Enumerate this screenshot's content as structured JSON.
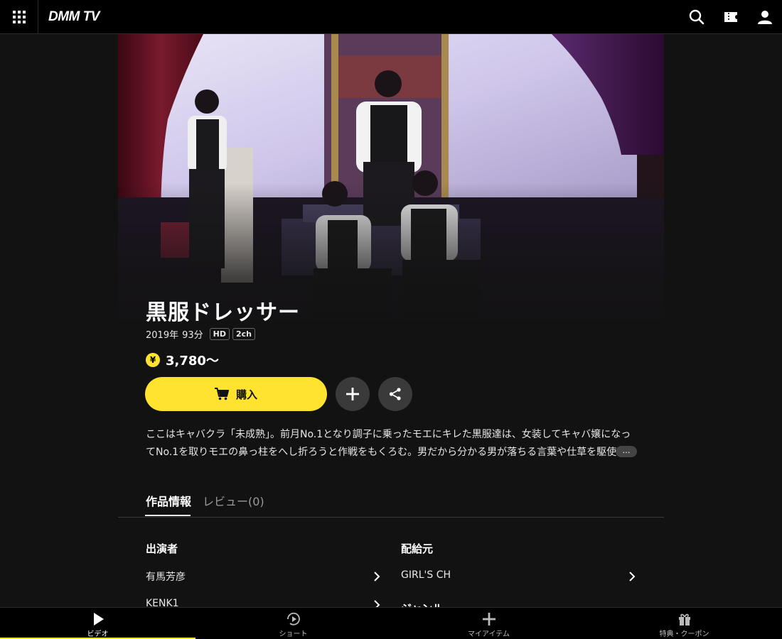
{
  "header": {
    "logo": "DMM TV"
  },
  "title": "黒服ドレッサー",
  "meta": {
    "year": "2019年",
    "duration": "93分",
    "badges": [
      "HD",
      "2ch"
    ]
  },
  "price": {
    "currency_symbol": "¥",
    "value": "3,780〜"
  },
  "actions": {
    "buy_label": "購入"
  },
  "description": "ここはキャバクラ「未成熟」。前月No.1となり調子に乗ったモエにキレた黒服達は、女装してキャバ嬢になってNo.1を取りモエの鼻っ柱をへし折ろうと作戦をもくろむ。男だから分かる男が落ちる言葉や仕草を駆使",
  "more_label": "…",
  "tabs": [
    {
      "label": "作品情報",
      "active": true
    },
    {
      "label": "レビュー(0)",
      "active": false
    }
  ],
  "info": {
    "cast_heading": "出演者",
    "cast": [
      "有馬芳彦",
      "KENK1"
    ],
    "distributor_heading": "配給元",
    "distributors": [
      "GIRL'S CH"
    ],
    "genre_heading": "ジャンル"
  },
  "bottom_nav": [
    {
      "label": "ビデオ",
      "icon": "play-icon",
      "active": true
    },
    {
      "label": "ショート",
      "icon": "short-play-icon",
      "active": false
    },
    {
      "label": "マイアイテム",
      "icon": "plus-icon",
      "active": false
    },
    {
      "label": "特典・クーポン",
      "icon": "gift-icon",
      "active": false
    }
  ],
  "colors": {
    "accent": "#ffe32e",
    "background": "#121212",
    "bar": "#000000"
  }
}
